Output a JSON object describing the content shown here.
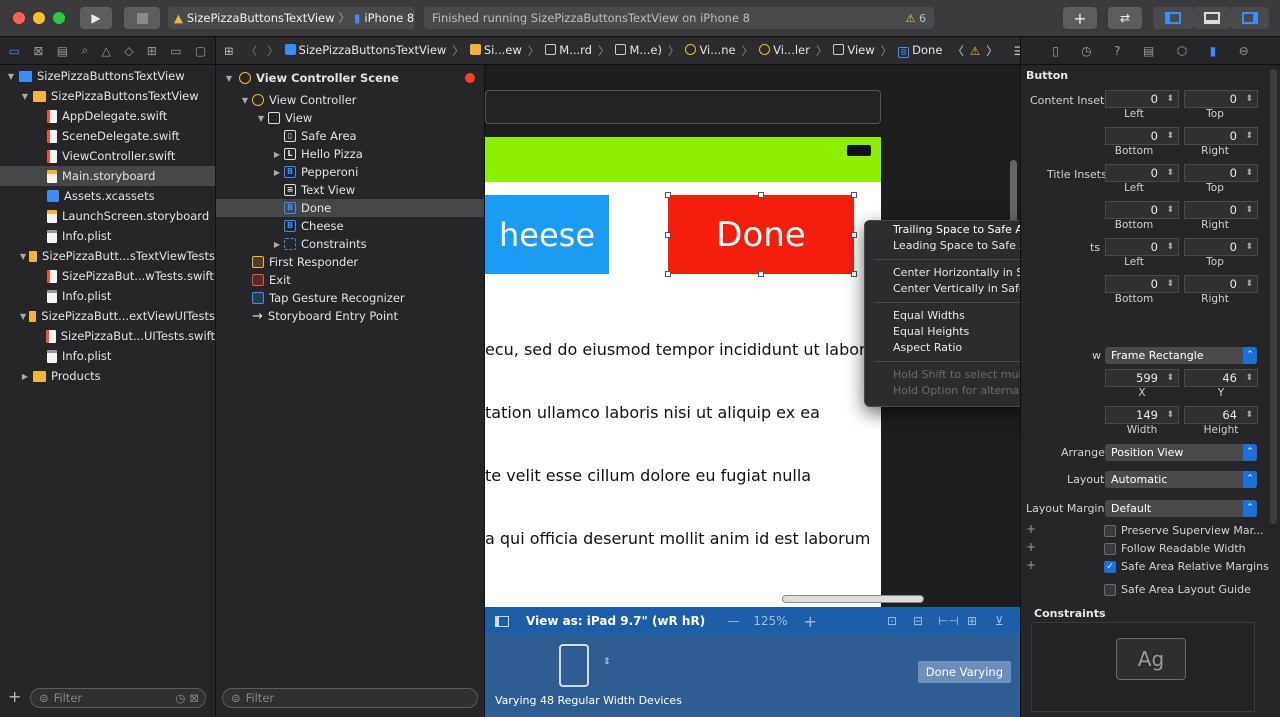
{
  "toolbar": {
    "scheme_target": "SizePizzaButtonsTextView",
    "device": "iPhone 8",
    "status": "Finished running SizePizzaButtonsTextView on iPhone 8",
    "warnings": "6"
  },
  "navigator": {
    "items": [
      {
        "label": "SizePizzaButtonsTextView",
        "indent": 0,
        "icon": "proj",
        "disclosure": "▼"
      },
      {
        "label": "SizePizzaButtonsTextView",
        "indent": 1,
        "icon": "folder",
        "disclosure": "▼"
      },
      {
        "label": "AppDelegate.swift",
        "indent": 2,
        "icon": "swift",
        "disclosure": ""
      },
      {
        "label": "SceneDelegate.swift",
        "indent": 2,
        "icon": "swift",
        "disclosure": ""
      },
      {
        "label": "ViewController.swift",
        "indent": 2,
        "icon": "swift",
        "disclosure": ""
      },
      {
        "label": "Main.storyboard",
        "indent": 2,
        "icon": "sb",
        "disclosure": "",
        "selected": true
      },
      {
        "label": "Assets.xcassets",
        "indent": 2,
        "icon": "asset",
        "disclosure": ""
      },
      {
        "label": "LaunchScreen.storyboard",
        "indent": 2,
        "icon": "sb",
        "disclosure": ""
      },
      {
        "label": "Info.plist",
        "indent": 2,
        "icon": "plist",
        "disclosure": ""
      },
      {
        "label": "SizePizzaButt...sTextViewTests",
        "indent": 1,
        "icon": "folder",
        "disclosure": "▼"
      },
      {
        "label": "SizePizzaBut...wTests.swift",
        "indent": 2,
        "icon": "swift",
        "disclosure": ""
      },
      {
        "label": "Info.plist",
        "indent": 2,
        "icon": "plist",
        "disclosure": ""
      },
      {
        "label": "SizePizzaButt...extViewUITests",
        "indent": 1,
        "icon": "folder",
        "disclosure": "▼"
      },
      {
        "label": "SizePizzaBut...UITests.swift",
        "indent": 2,
        "icon": "swift",
        "disclosure": ""
      },
      {
        "label": "Info.plist",
        "indent": 2,
        "icon": "plist",
        "disclosure": ""
      },
      {
        "label": "Products",
        "indent": 1,
        "icon": "folder",
        "disclosure": "▶"
      }
    ],
    "filter_placeholder": "Filter"
  },
  "jumpbar": {
    "crumbs": [
      "SizePizzaButtonsTextView",
      "Si...ew",
      "M...rd",
      "M...e)",
      "Vi...ne",
      "Vi...ler",
      "View",
      "Done"
    ]
  },
  "outline": {
    "scene": "View Controller Scene",
    "rows": [
      {
        "label": "View Controller",
        "indent": 1,
        "icon": "vc",
        "glyph": "",
        "disclosure": "▼"
      },
      {
        "label": "View",
        "indent": 2,
        "icon": "",
        "glyph": "",
        "disclosure": "▼"
      },
      {
        "label": "Safe Area",
        "indent": 3,
        "icon": "",
        "glyph": "▯",
        "disclosure": ""
      },
      {
        "label": "Hello Pizza",
        "indent": 3,
        "icon": "",
        "glyph": "L",
        "disclosure": "▶"
      },
      {
        "label": "Pepperoni",
        "indent": 3,
        "icon": "b",
        "glyph": "B",
        "disclosure": "▶"
      },
      {
        "label": "Text View",
        "indent": 3,
        "icon": "",
        "glyph": "≡",
        "disclosure": ""
      },
      {
        "label": "Done",
        "indent": 3,
        "icon": "b",
        "glyph": "B",
        "disclosure": "",
        "selected": true
      },
      {
        "label": "Cheese",
        "indent": 3,
        "icon": "b",
        "glyph": "B",
        "disclosure": ""
      },
      {
        "label": "Constraints",
        "indent": 3,
        "icon": "cons",
        "glyph": "",
        "disclosure": "▶"
      },
      {
        "label": "First Responder",
        "indent": 1,
        "icon": "fr",
        "glyph": "",
        "disclosure": ""
      },
      {
        "label": "Exit",
        "indent": 1,
        "icon": "ex",
        "glyph": "",
        "disclosure": ""
      },
      {
        "label": "Tap Gesture Recognizer",
        "indent": 1,
        "icon": "tap",
        "glyph": "",
        "disclosure": ""
      },
      {
        "label": "Storyboard Entry Point",
        "indent": 1,
        "icon": "arrow",
        "glyph": "→",
        "disclosure": ""
      }
    ],
    "filter_placeholder": "Filter"
  },
  "canvas": {
    "cheese_label": "heese",
    "done_label": "Done",
    "text_lines": [
      "ecu, sed do eiusmod tempor incididunt ut labore",
      "tation ullamco laboris nisi ut aliquip ex ea",
      "te velit esse cillum dolore eu fugiat nulla",
      "a qui officia deserunt mollit anim id est laborum"
    ],
    "view_as": "View as: iPad 9.7\" (wR hR)",
    "zoom": "125%",
    "varying": "Varying 48 Regular Width Devices",
    "done_varying": "Done Varying"
  },
  "menu": {
    "groups": [
      [
        {
          "label": "Trailing Space to Safe Area",
          "highlighted": true
        },
        {
          "label": "Leading Space to Safe Area"
        }
      ],
      [
        {
          "label": "Center Horizontally in Safe Area"
        },
        {
          "label": "Center Vertically in Safe Area"
        }
      ],
      [
        {
          "label": "Equal Widths"
        },
        {
          "label": "Equal Heights"
        },
        {
          "label": "Aspect Ratio"
        }
      ],
      [
        {
          "label": "Hold Shift to select multiple",
          "disabled": true
        },
        {
          "label": "Hold Option for alternates",
          "disabled": true
        }
      ]
    ]
  },
  "inspector": {
    "section": "Button",
    "content_insets_label": "Content Insets",
    "title_insets_label": "Title Insets",
    "insets_rows": [
      {
        "a": "0",
        "b": "0",
        "la": "Left",
        "lb": "Top"
      },
      {
        "a": "0",
        "b": "0",
        "la": "Bottom",
        "lb": "Right"
      },
      {
        "a": "0",
        "b": "0",
        "la": "Left",
        "lb": "Top"
      },
      {
        "a": "0",
        "b": "0",
        "la": "Bottom",
        "lb": "Right"
      },
      {
        "a": "0",
        "b": "0",
        "la": "Left",
        "lb": "Top"
      },
      {
        "a": "0",
        "b": "0",
        "la": "Bottom",
        "lb": "Right"
      }
    ],
    "insets_partial_label": "ts",
    "show_label": "w",
    "show_value": "Frame Rectangle",
    "x": "599",
    "y": "46",
    "x_label": "X",
    "y_label": "Y",
    "width": "149",
    "height": "64",
    "width_label": "Width",
    "height_label": "Height",
    "arrange_label": "Arrange",
    "arrange_value": "Position View",
    "layout_label": "Layout",
    "layout_value": "Automatic",
    "margins_label": "Layout Margins",
    "margins_value": "Default",
    "checks": [
      {
        "label": "Preserve Superview Mar...",
        "checked": false
      },
      {
        "label": "Follow Readable Width",
        "checked": false
      },
      {
        "label": "Safe Area Relative Margins",
        "checked": true
      },
      {
        "label": "Safe Area Layout Guide",
        "checked": false
      }
    ],
    "constraints_title": "Constraints",
    "ag_label": "Ag"
  }
}
